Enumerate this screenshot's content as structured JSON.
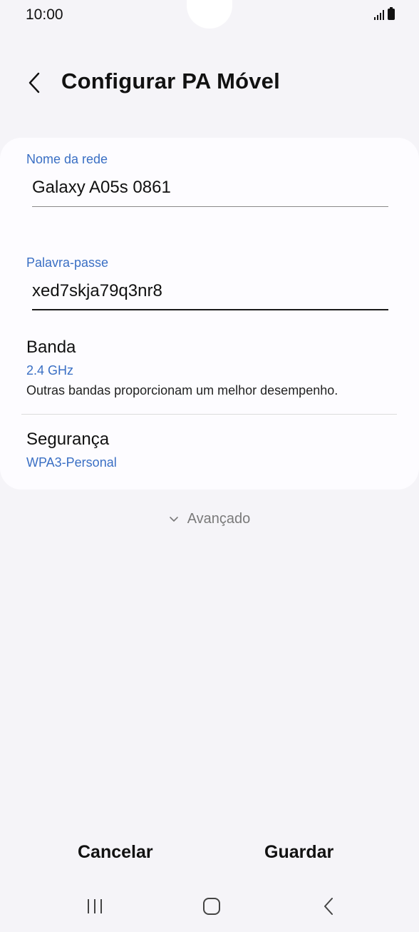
{
  "status_bar": {
    "time": "10:00"
  },
  "header": {
    "title": "Configurar PA Móvel",
    "back_icon": "chevron-left-icon"
  },
  "fields": {
    "network_name": {
      "label": "Nome da rede",
      "value": "Galaxy A05s 0861"
    },
    "password": {
      "label": "Palavra-passe",
      "value": "xed7skja79q3nr8"
    }
  },
  "band": {
    "title": "Banda",
    "value": "2.4 GHz",
    "description": "Outras bandas proporcionam um melhor desempenho."
  },
  "security": {
    "title": "Segurança",
    "value": "WPA3-Personal"
  },
  "advanced": {
    "label": "Avançado",
    "icon": "chevron-down-icon"
  },
  "actions": {
    "cancel_label": "Cancelar",
    "save_label": "Guardar"
  },
  "colors": {
    "accent": "#3a6fc4",
    "background": "#f5f4f8",
    "card": "#fdfcff"
  }
}
